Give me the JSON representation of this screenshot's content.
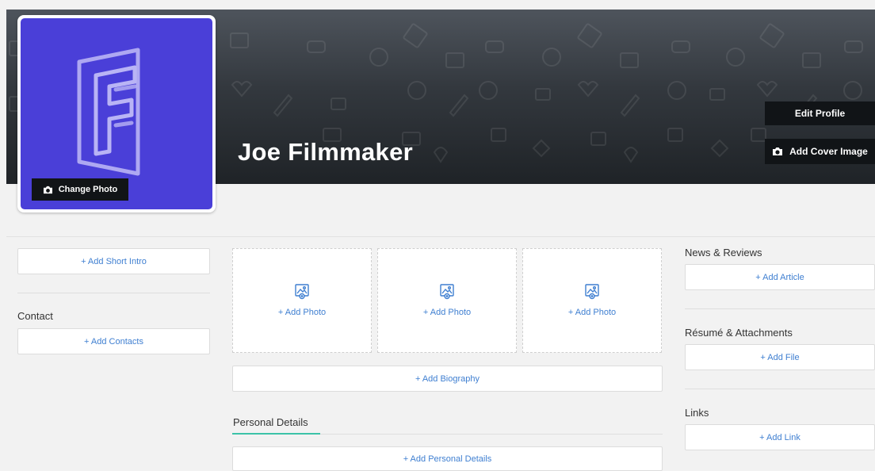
{
  "profile": {
    "name": "Joe Filmmaker",
    "change_photo_label": "Change Photo",
    "edit_profile_label": "Edit Profile",
    "add_cover_label": "Add Cover Image"
  },
  "left": {
    "short_intro_button": "+ Add Short Intro",
    "contact_heading": "Contact",
    "contacts_button": "+ Add Contacts"
  },
  "middle": {
    "photo_buttons": [
      "+ Add Photo",
      "+ Add Photo",
      "+ Add Photo"
    ],
    "biography_button": "+ Add Biography",
    "personal_details_heading": "Personal Details",
    "personal_details_button": "+ Add Personal Details"
  },
  "right": {
    "news_heading": "News & Reviews",
    "article_button": "+ Add Article",
    "resume_heading": "Résumé & Attachments",
    "file_button": "+ Add File",
    "links_heading": "Links",
    "link_button": "+ Add Link"
  },
  "colors": {
    "avatar_bg": "#4a3fd8",
    "link_blue": "#3f7fd1",
    "accent_teal": "#3cc3a8",
    "button_dark": "#111417"
  }
}
